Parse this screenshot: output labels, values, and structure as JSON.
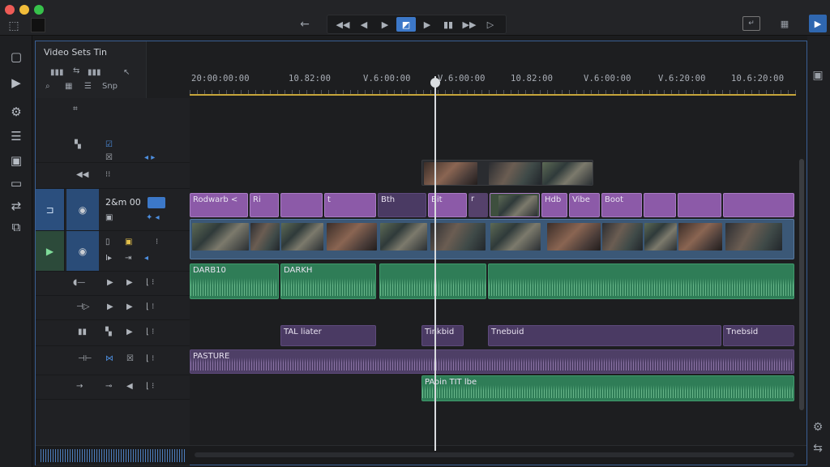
{
  "window": {
    "traffic_lights": [
      "close",
      "minimize",
      "zoom"
    ]
  },
  "transport": {
    "buttons": [
      "skip-back-icon",
      "step-back-icon",
      "step-forward-icon",
      "mark-in-icon",
      "play-icon",
      "marker-icon",
      "skip-forward-icon",
      "next-icon"
    ]
  },
  "top_panel": {
    "title": "Video Sets Tin",
    "label_a": "Snp"
  },
  "ruler": {
    "timecodes": [
      "20:00:00:00",
      "10.82:00",
      "V.6:00:00",
      "V.6:00:00",
      "10.82:00",
      "V.6:00:00",
      "V.6:20:00",
      "10.6:20:00"
    ]
  },
  "tracks": {
    "video_header_label": "2&m 00",
    "v1_clips": [
      "Rodwarb <",
      "Ri",
      "t",
      "Bth",
      "Bit",
      "r",
      "Hdb",
      "Vibe",
      "Boot"
    ],
    "a1_clips": [
      "DARB10",
      "DARKH"
    ],
    "a2_clips": [
      "TAL liater",
      "Tinkbid",
      "Tnebuid",
      "Tnebsid"
    ],
    "a3_clip": "PASTURE",
    "a4_clip": "PAoin TIT lbe"
  },
  "colors": {
    "accent_blue": "#3c78c8",
    "playhead": "#d9dcdf",
    "video_clip": "#8c5aa8",
    "audio_clip": "#2f7d57",
    "ruler_line": "#c6a53a"
  }
}
